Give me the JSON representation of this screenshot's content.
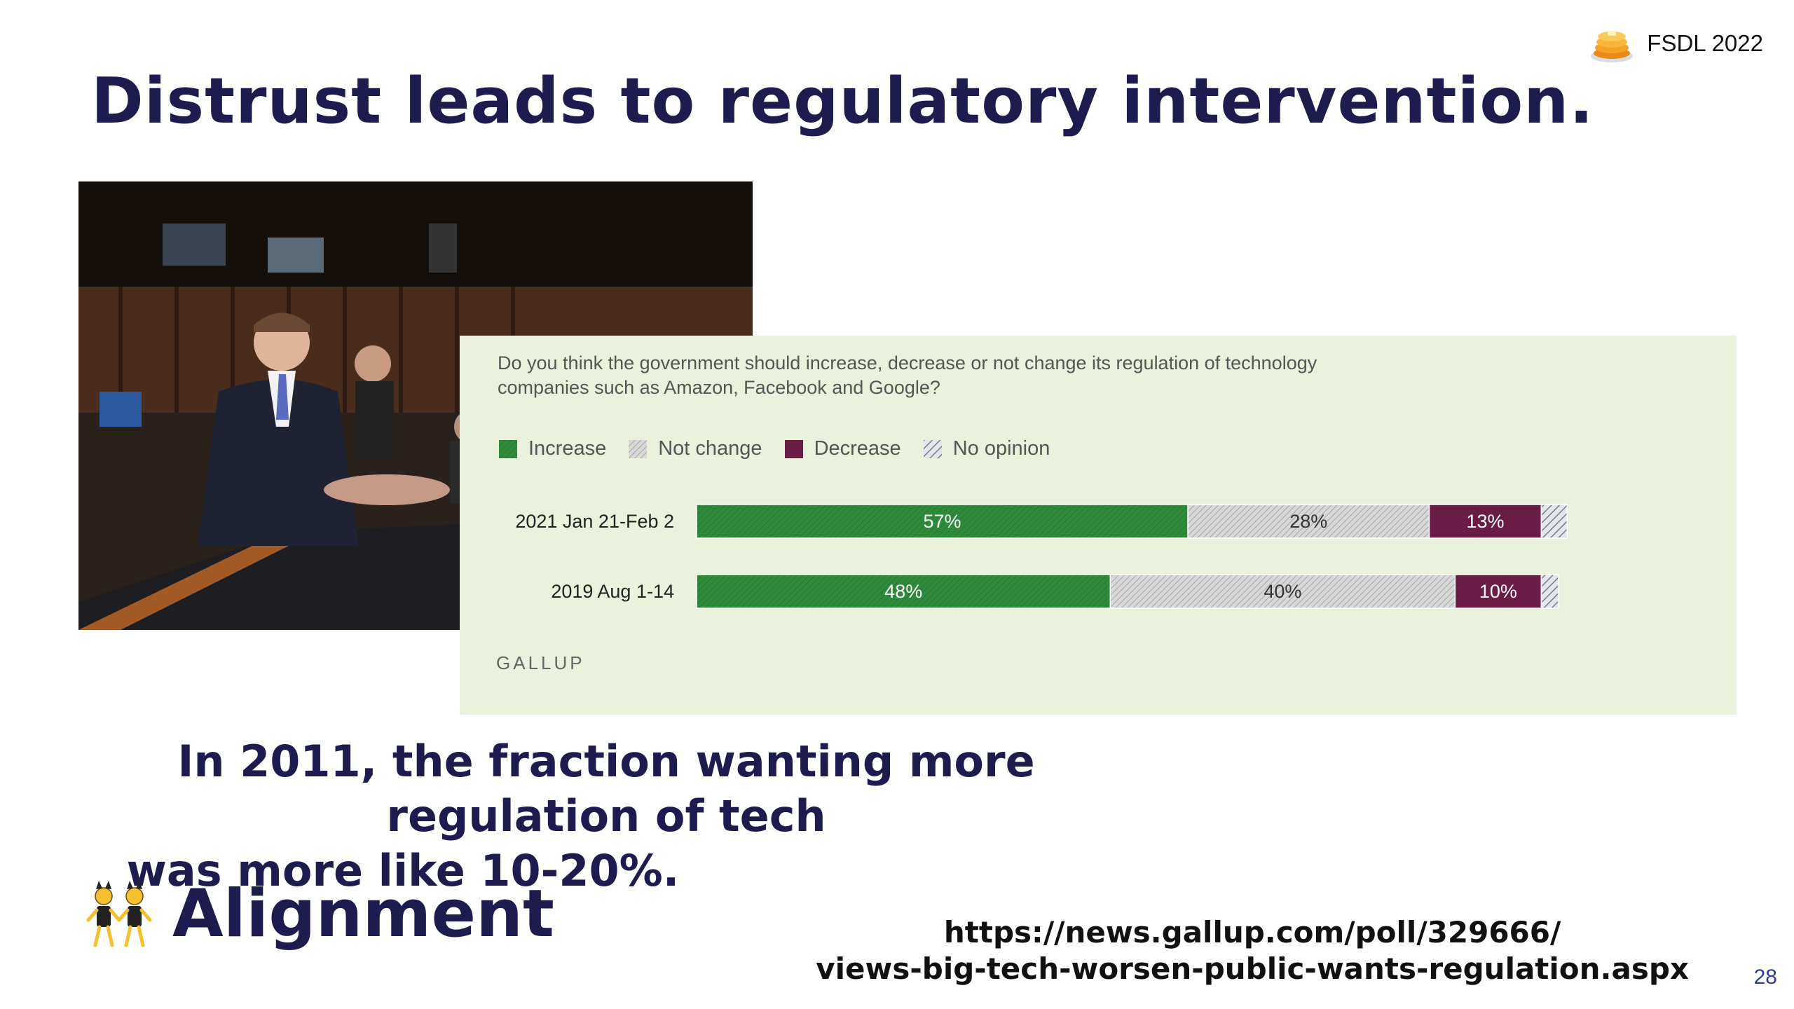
{
  "slide": {
    "brand": "FSDL 2022",
    "title": "Distrust leads to regulatory intervention.",
    "caption_line1": "In 2011, the fraction wanting more regulation of tech",
    "caption_line2": "was more like 10-20%.",
    "section": "Alignment",
    "source_line1": "https://news.gallup.com/poll/329666/",
    "source_line2": "views-big-tech-worsen-public-wants-regulation.aspx",
    "page_number": "28"
  },
  "chart_data": {
    "type": "bar",
    "orientation": "horizontal",
    "stacked": true,
    "title": "Do you think the government should increase, decrease or not change its regulation of technology companies such as Amazon, Facebook and Google?",
    "source": "GALLUP",
    "categories": [
      "2021 Jan 21-Feb 2",
      "2019 Aug 1-14"
    ],
    "series": [
      {
        "name": "Increase",
        "values": [
          57,
          48
        ],
        "labels": [
          "57%",
          "48%"
        ],
        "color": "#2e8b3a"
      },
      {
        "name": "Not change",
        "values": [
          28,
          40
        ],
        "labels": [
          "28%",
          "40%"
        ],
        "color": "#c8c8c8"
      },
      {
        "name": "Decrease",
        "values": [
          13,
          10
        ],
        "labels": [
          "13%",
          "10%"
        ],
        "color": "#6b1c44"
      },
      {
        "name": "No opinion",
        "values": [
          3,
          2
        ],
        "labels": [
          "",
          ""
        ],
        "color": "#a0a0a8"
      }
    ],
    "legend": "top-left"
  }
}
